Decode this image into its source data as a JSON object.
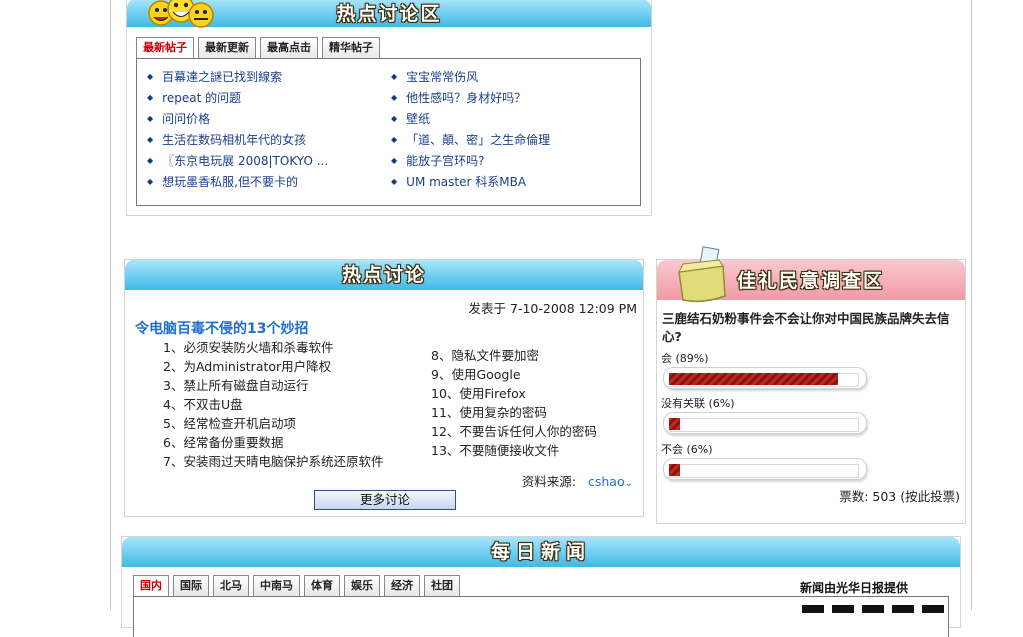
{
  "hot_forum": {
    "title": "热点讨论区",
    "tabs": [
      "最新帖子",
      "最新更新",
      "最高点击",
      "精华帖子"
    ],
    "left_items": [
      "百幕達之謎已找到線索",
      "repeat 的问题",
      "问问价格",
      "生活在数码相机年代的女孩",
      "〖东京电玩展 2008|TOKYO ...",
      "想玩墨香私服,但不要卡的"
    ],
    "right_items": [
      "宝宝常常伤风",
      "他性感吗？身材好吗？",
      "壁纸",
      "「道、顛、密」之生命倫理",
      "能放子宫环吗?",
      "UM master 科系MBA"
    ]
  },
  "hot_topic": {
    "title": "热点讨论",
    "posted": "发表于 7-10-2008 12:09 PM",
    "headline": "令电脑百毒不侵的13个妙招",
    "left_tips": [
      "1、必须安装防火墙和杀毒软件",
      "2、为Administrator用户降权",
      "3、禁止所有磁盘自动运行",
      "4、不双击U盘",
      "5、经常检查开机启动项",
      "6、经常备份重要数据",
      "7、安装雨过天晴电脑保护系统还原软件"
    ],
    "right_tips": [
      "8、隐私文件要加密",
      "9、使用Google",
      "10、使用Firefox",
      "11、使用复杂的密码",
      "12、不要告诉任何人你的密码",
      "13、不要随便接收文件"
    ],
    "source_label": "资料来源:",
    "source_author": "cshao",
    "more_button": "更多讨论"
  },
  "poll": {
    "title": "佳礼民意调查区",
    "question": "三鹿结石奶粉事件会不会让你对中国民族品牌失去信心?",
    "options": [
      {
        "label": "会 (89%)",
        "percent": 89
      },
      {
        "label": "没有关联 (6%)",
        "percent": 6
      },
      {
        "label": "不会 (6%)",
        "percent": 6
      }
    ],
    "votes": "票数: 503 (按此投票)"
  },
  "daily_news": {
    "title": "每日新闻",
    "tabs": [
      "国内",
      "国际",
      "北马",
      "中南马",
      "体育",
      "娱乐",
      "经济",
      "社团"
    ],
    "provider": "新闻由光华日报提供"
  }
}
